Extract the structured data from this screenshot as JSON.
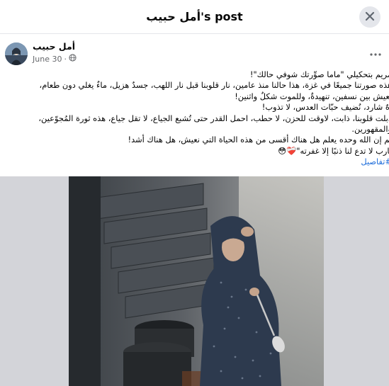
{
  "dialog": {
    "title": "أمل حبيب's post"
  },
  "post": {
    "author": "أمل حبيب",
    "date": "June 30",
    "privacy_icon": "globe-icon",
    "text_lines": [
      "مريم بتحكيلي \"ماما صوِّرتك شوفي حالك\"!",
      "هذه صورتنا جميعًا في غزة، هذا حالنا منذ عامين، نار قلوبنا قبل نار اللهب، جسدٌ هزيل، ماءٌ يغلي دون طعام،",
      "نعيش بين نسفين، تنهيدةٌ، وللموت شكلٌ واثنين!",
      "آهٌ شارد، نُضيف حبّات العدس، لا تذوب!",
      "ذبلت قلوبنا، ذابت، لاوقت للحزن، لا حطب، احمل القدر حتى تُشبع الجياع، لا تقل جياع، هذه ثورة المُجوّعين،",
      "والمقهورين.",
      "ثم إن الله وحده يعلم هل هناك أقسى من هذه الحياة التي نعيش، هل هناك أشد!",
      "يارب لا تدع لنا ذنبًا إلا غفرته\"❤️‍🩹😳"
    ],
    "hashtag": "#تفاصيل"
  },
  "icons": {
    "close": "close-icon",
    "more": "more-options-icon"
  },
  "colors": {
    "hashtag": "#216fdb",
    "meta": "#65676b",
    "photo_backdrop": "#d3d4d9"
  }
}
